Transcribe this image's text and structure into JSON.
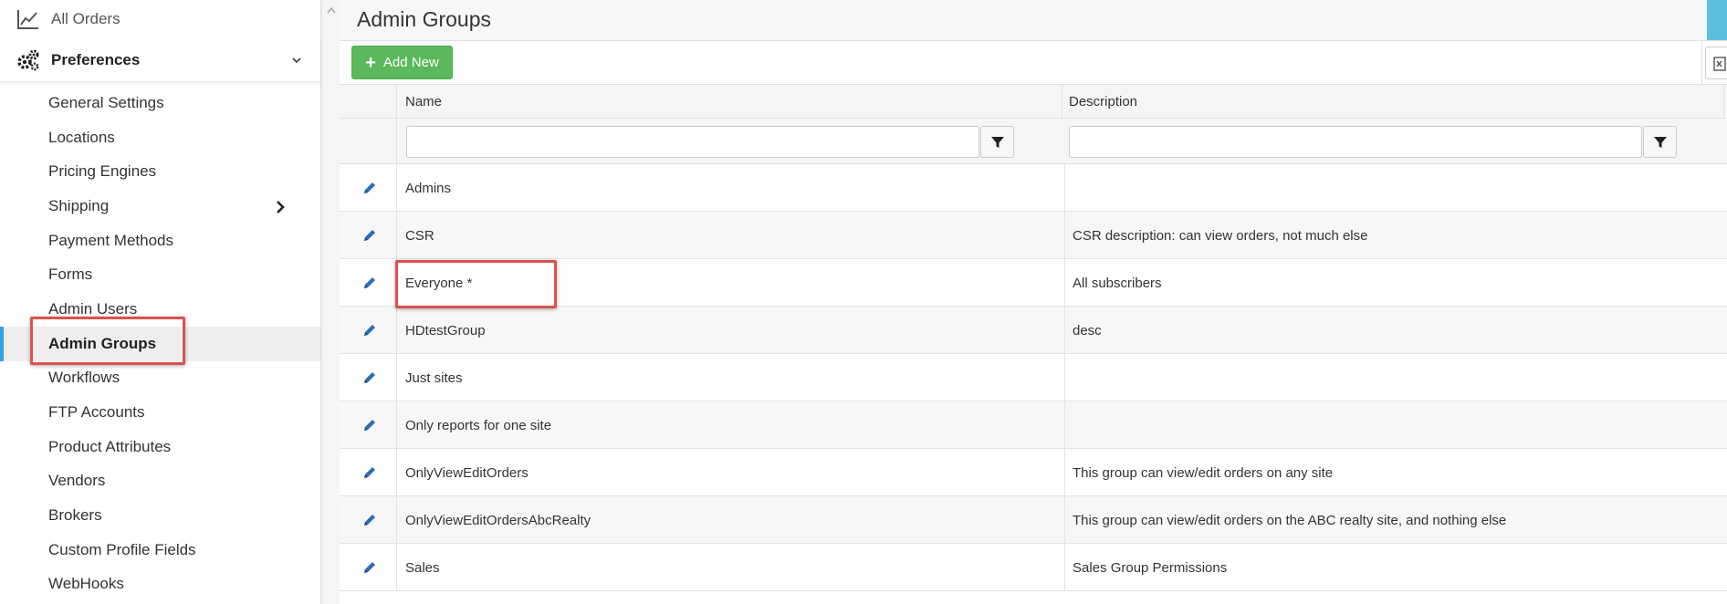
{
  "sidebar": {
    "all_orders_label": "All Orders",
    "preferences_label": "Preferences",
    "items": [
      {
        "label": "General Settings"
      },
      {
        "label": "Locations"
      },
      {
        "label": "Pricing Engines"
      },
      {
        "label": "Shipping"
      },
      {
        "label": "Payment Methods"
      },
      {
        "label": "Forms"
      },
      {
        "label": "Admin Users"
      },
      {
        "label": "Admin Groups"
      },
      {
        "label": "Workflows"
      },
      {
        "label": "FTP Accounts"
      },
      {
        "label": "Product Attributes"
      },
      {
        "label": "Vendors"
      },
      {
        "label": "Brokers"
      },
      {
        "label": "Custom Profile Fields"
      },
      {
        "label": "WebHooks"
      }
    ],
    "active_item": "Admin Groups"
  },
  "main": {
    "title": "Admin Groups",
    "add_button_label": "Add New"
  },
  "grid": {
    "columns": {
      "name": "Name",
      "description": "Description"
    },
    "filters": {
      "name_value": "",
      "description_value": ""
    },
    "rows": [
      {
        "name": "Admins",
        "description": ""
      },
      {
        "name": "CSR",
        "description": "CSR description: can view orders, not much else"
      },
      {
        "name": "Everyone *",
        "description": "All subscribers"
      },
      {
        "name": "HDtestGroup",
        "description": "desc"
      },
      {
        "name": "Just sites",
        "description": ""
      },
      {
        "name": "Only reports for one site",
        "description": ""
      },
      {
        "name": "OnlyViewEditOrders",
        "description": "This group can view/edit orders on any site"
      },
      {
        "name": "OnlyViewEditOrdersAbcRealty",
        "description": "This group can view/edit orders on the ABC realty site, and nothing else"
      },
      {
        "name": "Sales",
        "description": "Sales Group Permissions"
      }
    ]
  },
  "colors": {
    "accent": "#2ea3e0",
    "add_button": "#5cb85c",
    "highlight": "#d9534f",
    "edit_icon": "#2a6fb5"
  },
  "icons": {
    "all_orders": "chart-line-icon",
    "preferences": "gears-icon",
    "collapse": "chevron-down-icon",
    "submenu": "chevron-right-icon",
    "add": "plus-icon",
    "filter": "funnel-icon",
    "edit": "pencil-icon",
    "export": "excel-icon"
  }
}
